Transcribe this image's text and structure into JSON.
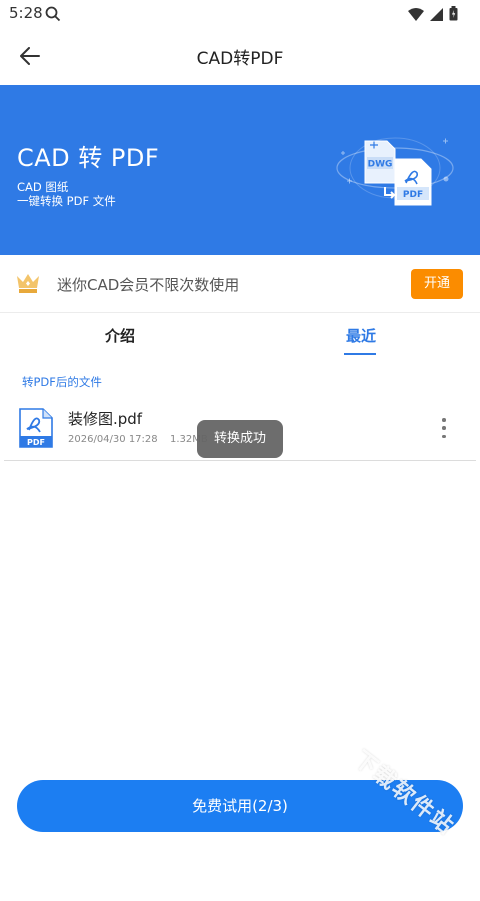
{
  "status_bar": {
    "time": "5:28"
  },
  "app_bar": {
    "title": "CAD转PDF"
  },
  "banner": {
    "title": "CAD 转 PDF",
    "line1": "CAD 图纸",
    "line2": "一键转换 PDF 文件",
    "art": {
      "dwg_label": "DWG",
      "pdf_label": "PDF"
    }
  },
  "membership": {
    "text": "迷你CAD会员不限次数使用",
    "button": "开通"
  },
  "tabs": [
    {
      "label": "介绍",
      "active": false
    },
    {
      "label": "最近",
      "active": true
    }
  ],
  "section_label": "转PDF后的文件",
  "files": [
    {
      "name": "装修图.pdf",
      "date": "2026/04/30 17:28",
      "size": "1.32MB",
      "icon_label": "PDF"
    }
  ],
  "toast": "转换成功",
  "cta": "免费试用(2/3)",
  "watermark": "下载软件站",
  "colors": {
    "primary": "#2f7ae5",
    "button": "#1c7ef2",
    "accent": "#fb8c00"
  }
}
